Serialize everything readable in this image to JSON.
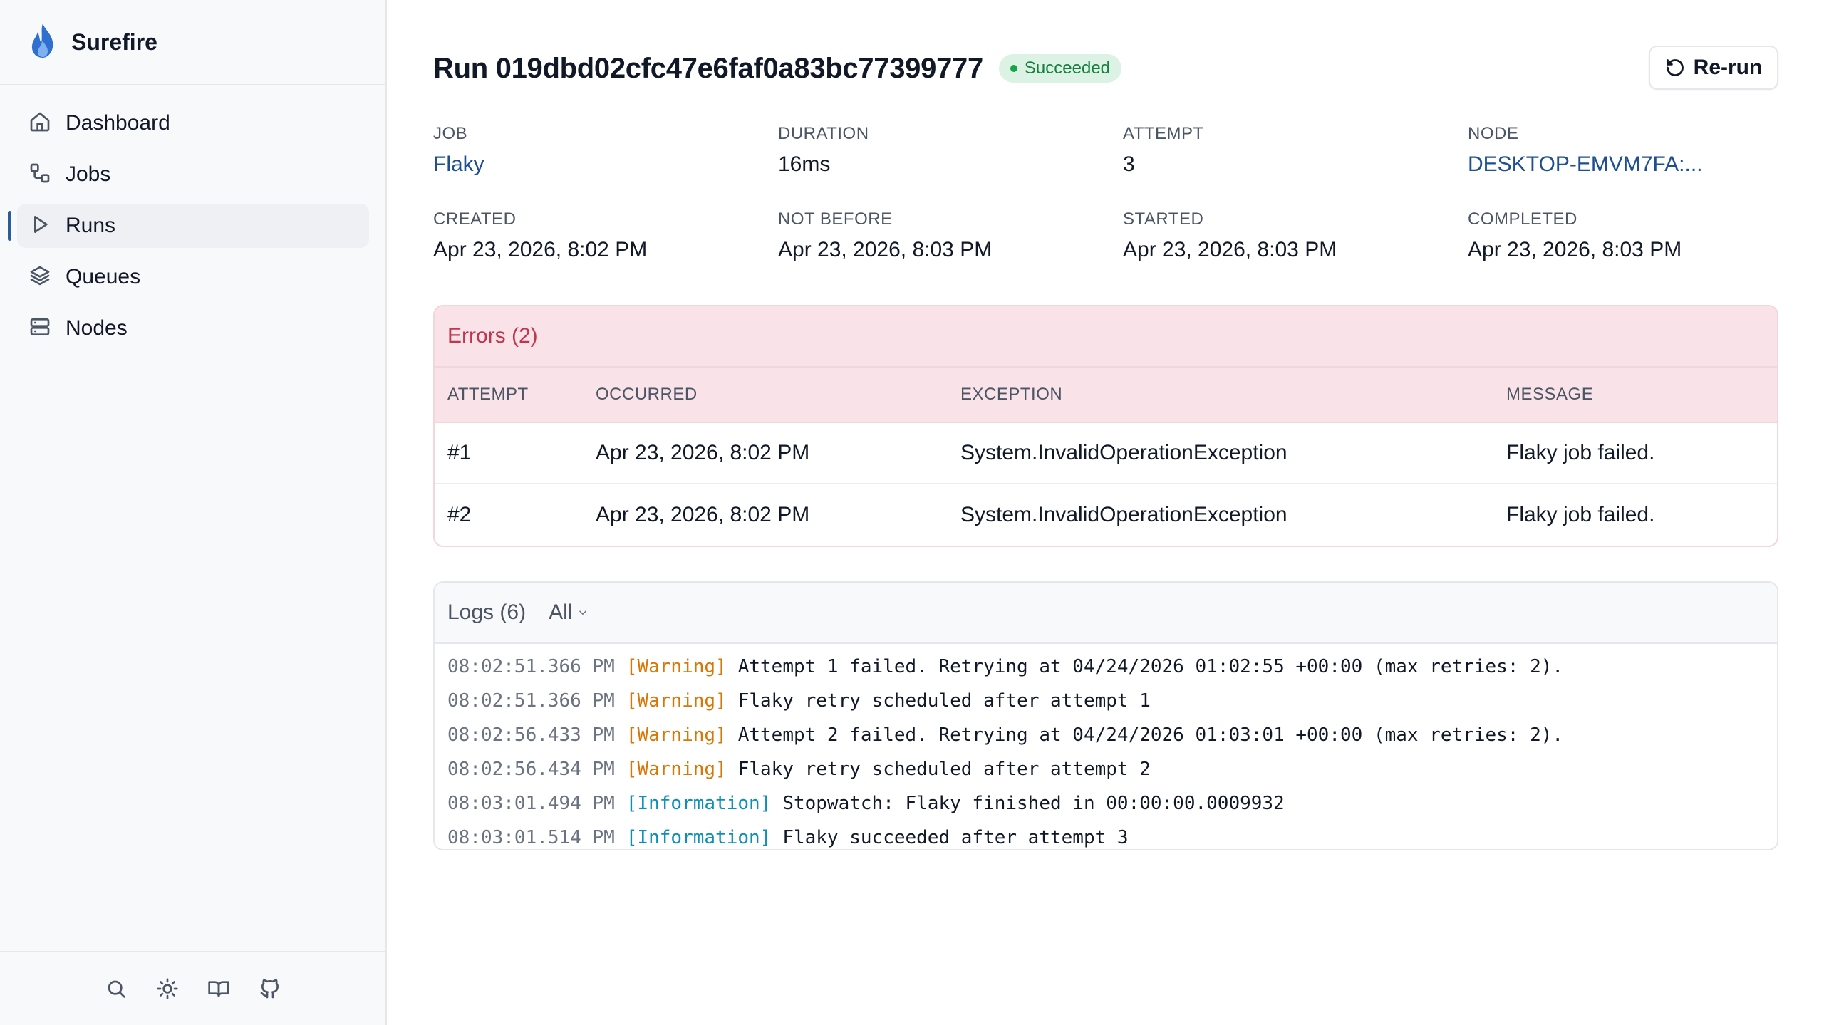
{
  "app": {
    "name": "Surefire"
  },
  "nav": {
    "items": [
      {
        "label": "Dashboard",
        "icon": "home-icon"
      },
      {
        "label": "Jobs",
        "icon": "jobs-icon"
      },
      {
        "label": "Runs",
        "icon": "play-icon",
        "active": true
      },
      {
        "label": "Queues",
        "icon": "layers-icon"
      },
      {
        "label": "Nodes",
        "icon": "server-icon"
      }
    ]
  },
  "footer_icons": [
    "search-icon",
    "sun-icon",
    "book-icon",
    "github-icon"
  ],
  "run": {
    "title": "Run 019dbd02cfc47e6faf0a83bc77399777",
    "status": "Succeeded",
    "rerun_label": "Re-run"
  },
  "meta": [
    {
      "label": "JOB",
      "value": "Flaky",
      "link": true
    },
    {
      "label": "DURATION",
      "value": "16ms"
    },
    {
      "label": "ATTEMPT",
      "value": "3"
    },
    {
      "label": "NODE",
      "value": "DESKTOP-EMVM7FA:...",
      "link": true
    },
    {
      "label": "CREATED",
      "value": "Apr 23, 2026, 8:02 PM"
    },
    {
      "label": "NOT BEFORE",
      "value": "Apr 23, 2026, 8:03 PM"
    },
    {
      "label": "STARTED",
      "value": "Apr 23, 2026, 8:03 PM"
    },
    {
      "label": "COMPLETED",
      "value": "Apr 23, 2026, 8:03 PM"
    }
  ],
  "errors": {
    "title": "Errors (2)",
    "columns": [
      "ATTEMPT",
      "OCCURRED",
      "EXCEPTION",
      "MESSAGE"
    ],
    "rows": [
      [
        "#1",
        "Apr 23, 2026, 8:02 PM",
        "System.InvalidOperationException",
        "Flaky job failed."
      ],
      [
        "#2",
        "Apr 23, 2026, 8:02 PM",
        "System.InvalidOperationException",
        "Flaky job failed."
      ]
    ]
  },
  "logs": {
    "title": "Logs (6)",
    "filter": "All",
    "lines": [
      {
        "time": "08:02:51.366 PM",
        "level": "[Warning]",
        "kind": "warning",
        "message": "Attempt 1 failed. Retrying at 04/24/2026 01:02:55 +00:00 (max retries: 2)."
      },
      {
        "time": "08:02:51.366 PM",
        "level": "[Warning]",
        "kind": "warning",
        "message": "Flaky retry scheduled after attempt 1"
      },
      {
        "time": "08:02:56.433 PM",
        "level": "[Warning]",
        "kind": "warning",
        "message": "Attempt 2 failed. Retrying at 04/24/2026 01:03:01 +00:00 (max retries: 2)."
      },
      {
        "time": "08:02:56.434 PM",
        "level": "[Warning]",
        "kind": "warning",
        "message": "Flaky retry scheduled after attempt 2"
      },
      {
        "time": "08:03:01.494 PM",
        "level": "[Information]",
        "kind": "information",
        "message": "Stopwatch: Flaky finished in 00:00:00.0009932"
      },
      {
        "time": "08:03:01.514 PM",
        "level": "[Information]",
        "kind": "information",
        "message": "Flaky succeeded after attempt 3"
      }
    ]
  },
  "colors": {
    "accent": "#2a5c9a",
    "success": "#15803d",
    "error": "#c0364f",
    "warning": "#d97706",
    "information": "#0e8fb8"
  }
}
